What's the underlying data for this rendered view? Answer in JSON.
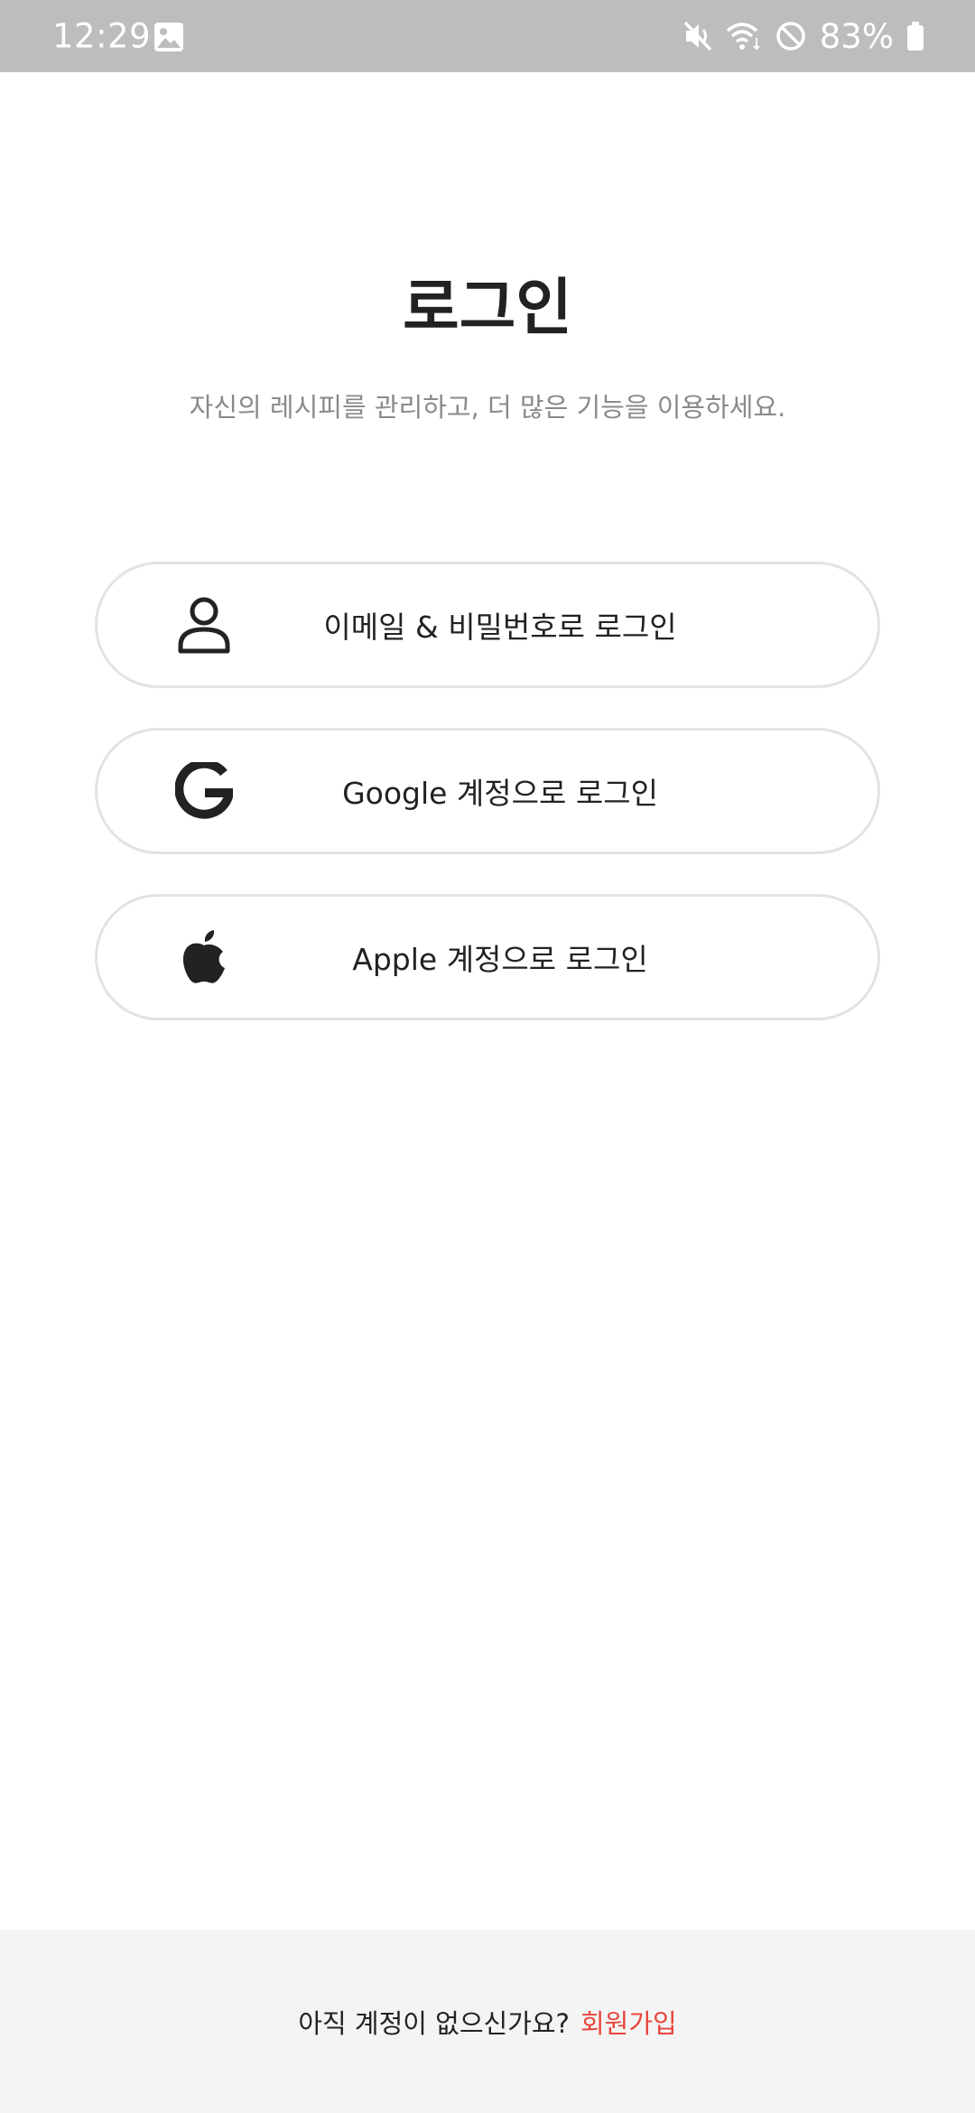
{
  "status_bar": {
    "time": "12:29",
    "battery": "83%",
    "icons": [
      "gallery-icon",
      "mute-icon",
      "wifi-icon",
      "do-not-disturb-icon",
      "battery-icon"
    ]
  },
  "login": {
    "title": "로그인",
    "subtitle": "자신의 레시피를 관리하고, 더 많은 기능을 이용하세요.",
    "buttons": [
      {
        "label": "이메일 & 비밀번호로 로그인",
        "icon": "person-icon"
      },
      {
        "label": "Google 계정으로 로그인",
        "icon": "google-icon"
      },
      {
        "label": "Apple 계정으로 로그인",
        "icon": "apple-icon"
      }
    ]
  },
  "footer": {
    "question": "아직 계정이 없으신가요?",
    "signup_label": "회원가입"
  },
  "colors": {
    "status_bar_bg": "#bdbdbd",
    "text_primary": "#222222",
    "text_secondary": "#8a8a8a",
    "button_border": "#e3e3e3",
    "footer_bg": "#f4f4f4",
    "accent": "#e8463c"
  }
}
